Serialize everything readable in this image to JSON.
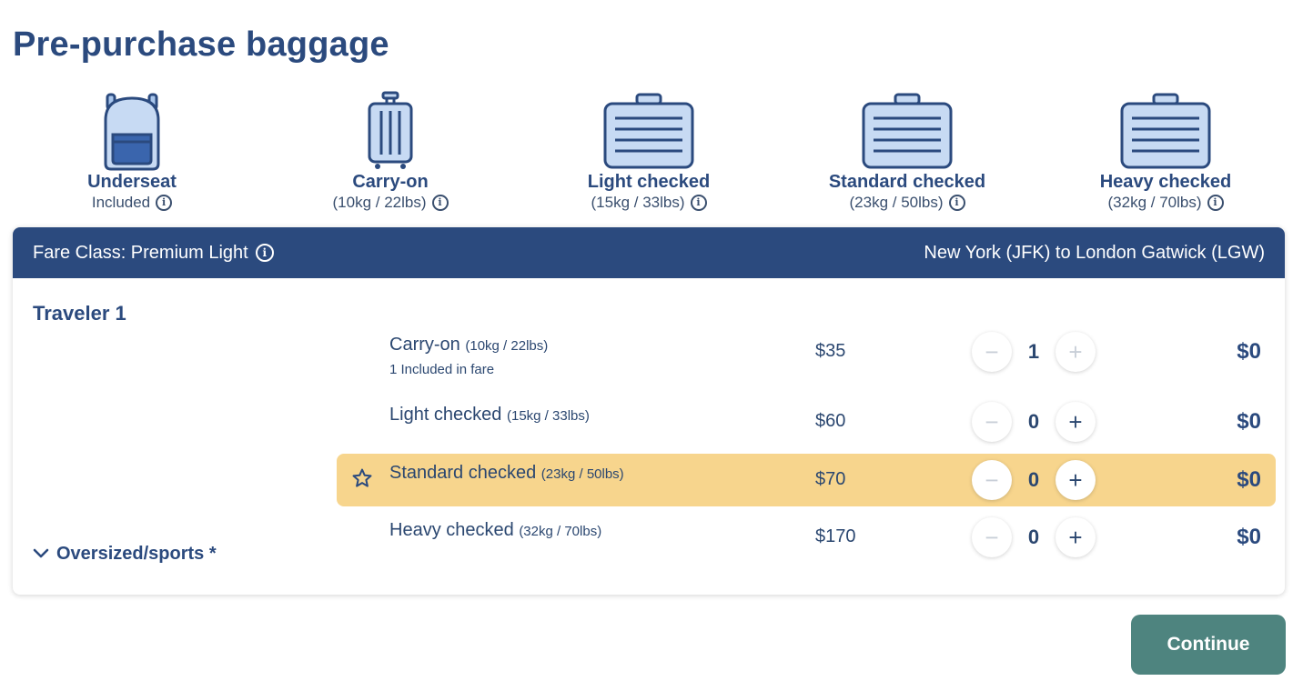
{
  "page": {
    "title": "Pre-purchase baggage"
  },
  "bags": [
    {
      "name": "Underseat",
      "sub": "Included",
      "icon": "backpack-icon"
    },
    {
      "name": "Carry-on",
      "sub": "(10kg / 22lbs)",
      "icon": "carry-on-suitcase-icon"
    },
    {
      "name": "Light checked",
      "sub": "(15kg / 33lbs)",
      "icon": "checked-bag-icon"
    },
    {
      "name": "Standard checked",
      "sub": "(23kg / 50lbs)",
      "icon": "checked-bag-icon"
    },
    {
      "name": "Heavy checked",
      "sub": "(32kg / 70lbs)",
      "icon": "checked-bag-icon"
    }
  ],
  "panel": {
    "fare_class": "Fare Class: Premium Light",
    "route": "New York (JFK) to London Gatwick (LGW)",
    "traveler": "Traveler 1",
    "oversized": "Oversized/sports *",
    "rows": [
      {
        "label": "Carry-on",
        "weight": "(10kg / 22lbs)",
        "note": "1 Included in fare",
        "price": "$35",
        "qty": "1",
        "total": "$0",
        "minus_disabled": true,
        "plus_disabled": true,
        "highlighted": false
      },
      {
        "label": "Light checked",
        "weight": "(15kg / 33lbs)",
        "note": "",
        "price": "$60",
        "qty": "0",
        "total": "$0",
        "minus_disabled": true,
        "plus_disabled": false,
        "highlighted": false
      },
      {
        "label": "Standard checked",
        "weight": "(23kg / 50lbs)",
        "note": "",
        "price": "$70",
        "qty": "0",
        "total": "$0",
        "minus_disabled": true,
        "plus_disabled": false,
        "highlighted": true
      },
      {
        "label": "Heavy checked",
        "weight": "(32kg / 70lbs)",
        "note": "",
        "price": "$170",
        "qty": "0",
        "total": "$0",
        "minus_disabled": true,
        "plus_disabled": false,
        "highlighted": false
      }
    ]
  },
  "actions": {
    "continue_label": "Continue"
  },
  "colors": {
    "navy": "#2b4a7e",
    "highlight": "#f7d58d",
    "continue": "#4e847f"
  }
}
